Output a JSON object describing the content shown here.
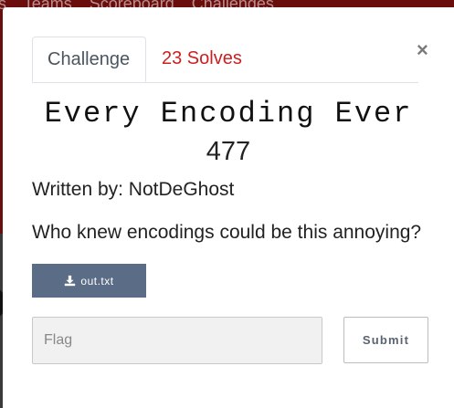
{
  "background": {
    "nav_items": [
      "rs",
      "Teams",
      "Scoreboard",
      "Challenges"
    ]
  },
  "modal": {
    "close_label": "×",
    "tabs": [
      {
        "label": "Challenge"
      },
      {
        "label": "23 Solves"
      }
    ],
    "title": "Every Encoding Ever",
    "value": "477",
    "author": "Written by: NotDeGhost",
    "description": "Who knew encodings could be this annoying?",
    "file_button": {
      "label": "out.txt",
      "icon": "download-icon"
    },
    "flag_input": {
      "placeholder": "Flag",
      "value": ""
    },
    "submit_label": "Submit"
  },
  "colors": {
    "solves_tab": "#cc1f1f",
    "file_button_bg": "#5b6d86",
    "nav_bg": "#6a0d0d"
  }
}
